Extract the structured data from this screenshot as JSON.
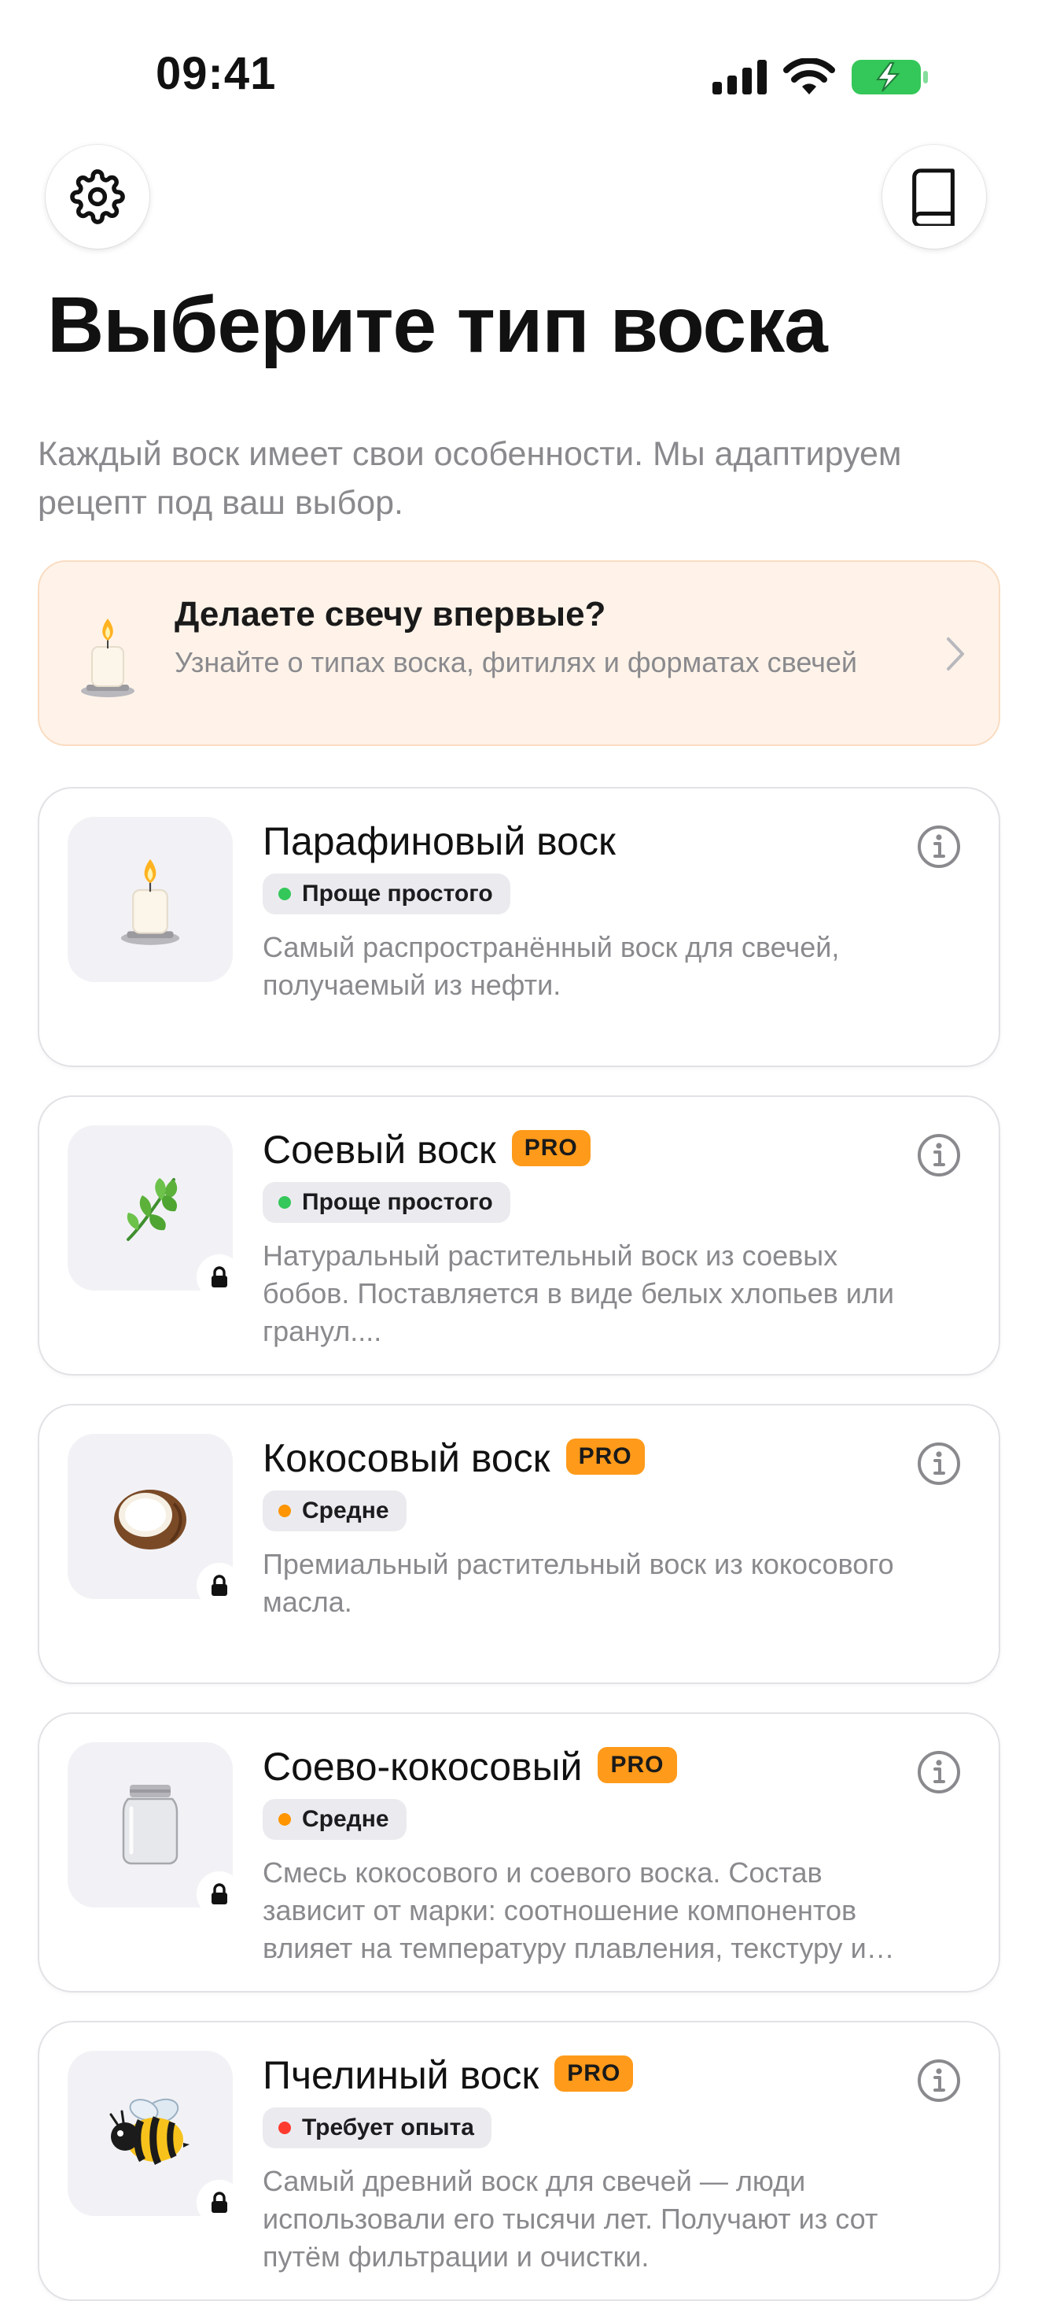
{
  "status_bar": {
    "time": "09:41",
    "signal_icon": "cellular-signal-icon",
    "wifi_icon": "wifi-icon",
    "battery_icon": "battery-charging-icon",
    "battery_color": "#34c759"
  },
  "header": {
    "settings_icon": "gear-icon",
    "guide_icon": "book-icon"
  },
  "title": "Выберите тип воска",
  "subtitle": "Каждый воск имеет свои особенности. Мы адаптируем рецепт под ваш выбор.",
  "beginner_banner": {
    "title": "Делаете свечу впервые?",
    "description": "Узнайте о типах воска, фитилях и форматах свечей",
    "icon": "candle-icon",
    "background": "#fff3e9"
  },
  "pro_label": "PRO",
  "accent_pro": "#ff9a1a",
  "wax_types": [
    {
      "name": "Парафиновый воск",
      "pro": false,
      "locked": false,
      "difficulty": "Проще простого",
      "difficulty_color": "#34c759",
      "description": "Самый распространённый воск для свечей, получаемый из нефти.",
      "icon": "candle-icon"
    },
    {
      "name": "Соевый воск",
      "pro": true,
      "locked": true,
      "difficulty": "Проще простого",
      "difficulty_color": "#34c759",
      "description": "Натуральный растительный воск из соевых бобов. Поставляется в виде белых хлопьев или гранул....",
      "icon": "herb-leaf-icon"
    },
    {
      "name": "Кокосовый воск",
      "pro": true,
      "locked": true,
      "difficulty": "Средне",
      "difficulty_color": "#ff9500",
      "description": "Премиальный растительный воск из кокосового масла.",
      "icon": "coconut-icon"
    },
    {
      "name": "Соево-кокосовый",
      "pro": true,
      "locked": true,
      "difficulty": "Средне",
      "difficulty_color": "#ff9500",
      "description": "Смесь кокосового и соевого воска. Состав зависит от марки: соотношение компонентов влияет на температуру плавления, текстуру и аромат.",
      "icon": "glass-jar-icon"
    },
    {
      "name": "Пчелиный воск",
      "pro": true,
      "locked": true,
      "difficulty": "Требует опыта",
      "difficulty_color": "#ff3b30",
      "description": "Самый древний воск для свечей — люди использовали его тысячи лет. Получают из сот путём фильтрации и очистки.",
      "icon": "bee-icon"
    }
  ]
}
